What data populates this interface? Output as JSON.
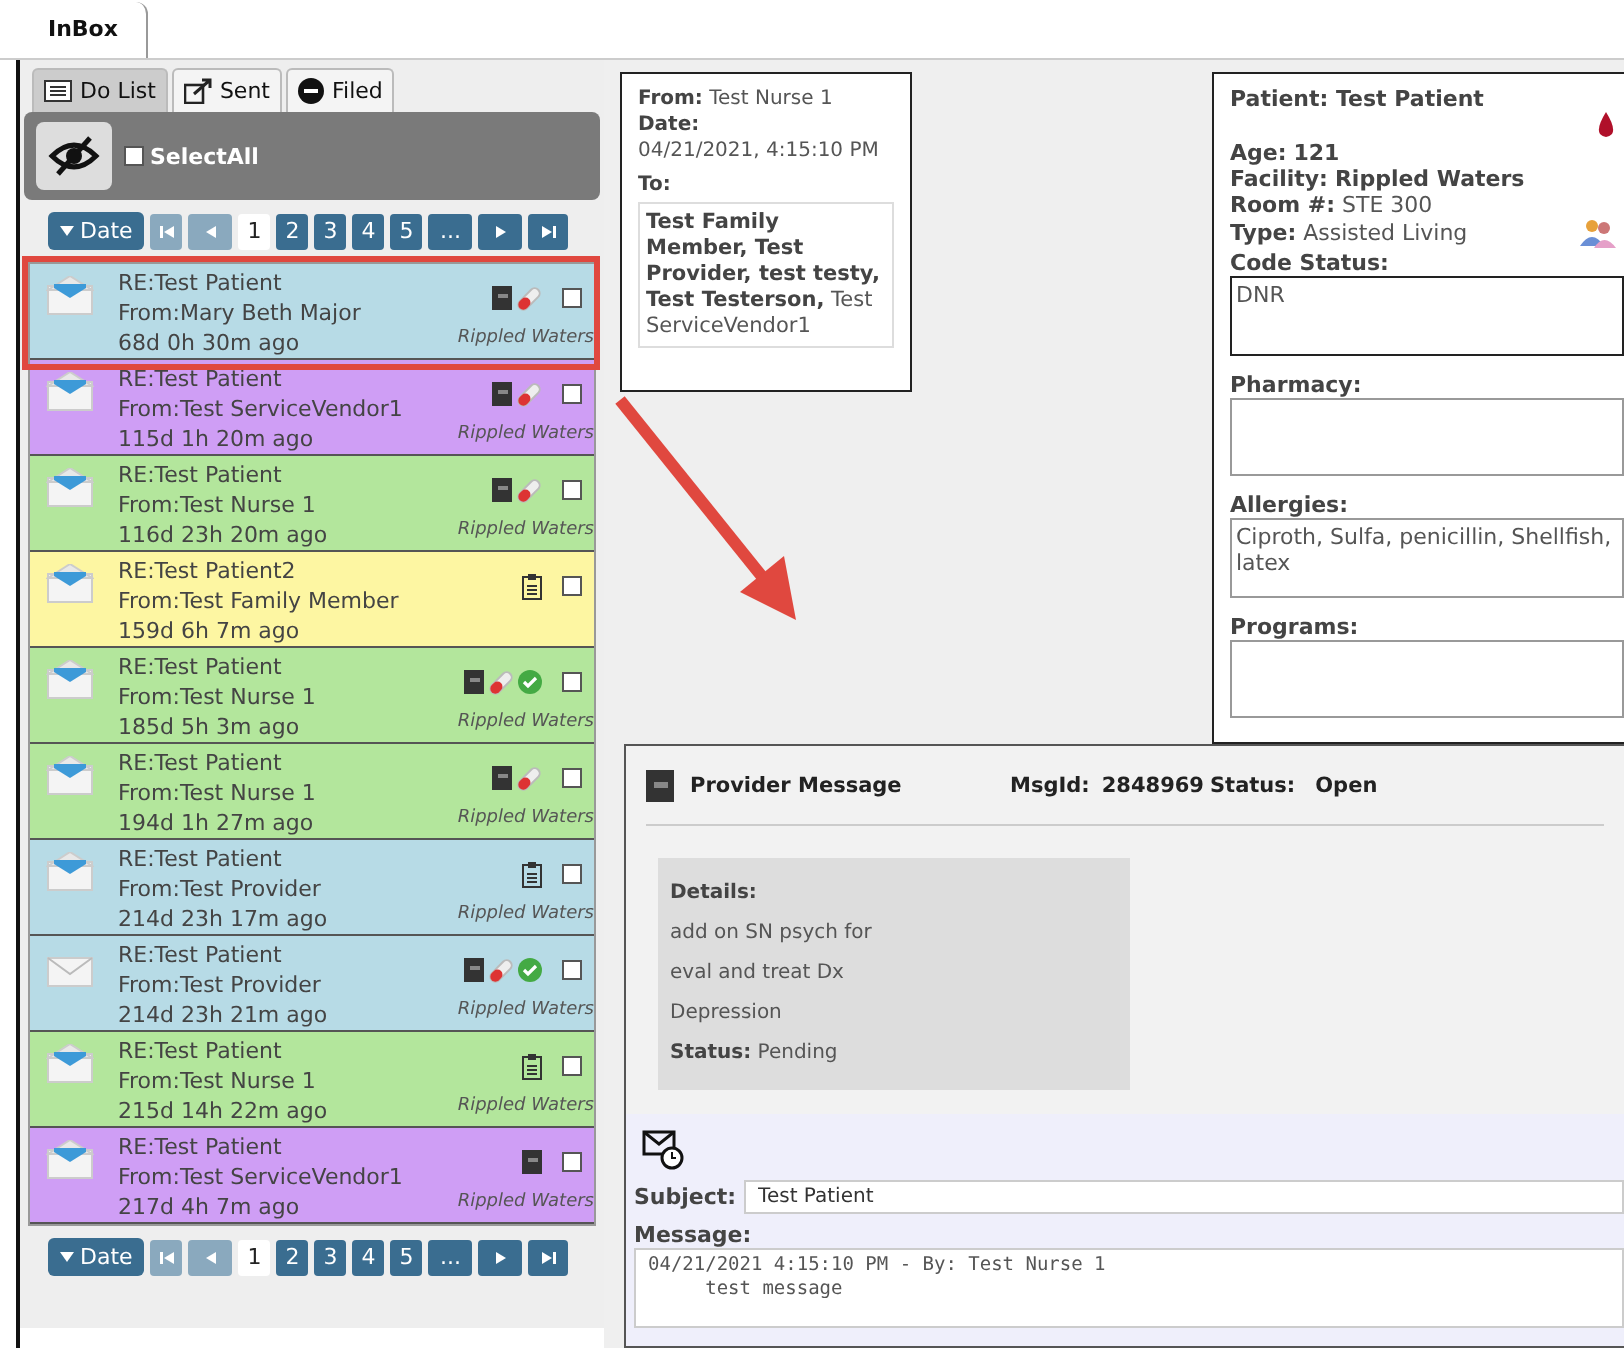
{
  "window": {
    "tab": "InBox"
  },
  "list_tabs": [
    {
      "label": "Do List",
      "kind": "list",
      "selected": true
    },
    {
      "label": "Sent",
      "kind": "send",
      "selected": false
    },
    {
      "label": "Filed",
      "kind": "minus",
      "selected": false
    }
  ],
  "select_all": {
    "label": "SelectAll",
    "checked": false
  },
  "pager_top": {
    "sort": "Date",
    "pages": [
      {
        "label": "1",
        "selected": true
      },
      {
        "label": "2",
        "selected": false
      },
      {
        "label": "3",
        "selected": false
      },
      {
        "label": "4",
        "selected": false
      },
      {
        "label": "5",
        "selected": false
      },
      {
        "label": "...",
        "selected": false
      }
    ]
  },
  "messages": [
    {
      "subject": "RE:Test Patient",
      "from": "From:Mary Beth Major",
      "ago": "68d 0h 30m ago",
      "facility": "Rippled Waters",
      "color": "#b7dbe6",
      "read": false,
      "icons": [
        {
          "kind": "doc"
        },
        {
          "kind": "pill"
        }
      ],
      "checked": false,
      "selected": true
    },
    {
      "subject": "RE:Test Patient",
      "from": "From:Test ServiceVendor1",
      "ago": "115d 1h 20m ago",
      "facility": "Rippled Waters",
      "color": "#cf9ef5",
      "read": false,
      "icons": [
        {
          "kind": "doc"
        },
        {
          "kind": "pill"
        }
      ],
      "checked": false,
      "selected": false
    },
    {
      "subject": "RE:Test Patient",
      "from": "From:Test Nurse 1",
      "ago": "116d 23h 20m ago",
      "facility": "Rippled Waters",
      "color": "#b3e69c",
      "read": false,
      "icons": [
        {
          "kind": "doc"
        },
        {
          "kind": "pill"
        }
      ],
      "checked": false,
      "selected": false
    },
    {
      "subject": "RE:Test Patient2",
      "from": "From:Test Family Member",
      "ago": "159d 6h 7m ago",
      "color": "#fdf6a2",
      "read": false,
      "icons": [
        {
          "kind": "clipboard"
        }
      ],
      "checked": false,
      "selected": false
    },
    {
      "subject": "RE:Test Patient",
      "from": "From:Test Nurse 1",
      "ago": "185d 5h 3m ago",
      "facility": "Rippled Waters",
      "color": "#b3e69c",
      "read": false,
      "icons": [
        {
          "kind": "doc"
        },
        {
          "kind": "pill"
        },
        {
          "kind": "check"
        }
      ],
      "checked": false,
      "selected": false
    },
    {
      "subject": "RE:Test Patient",
      "from": "From:Test Nurse 1",
      "ago": "194d 1h 27m ago",
      "facility": "Rippled Waters",
      "color": "#b3e69c",
      "read": false,
      "icons": [
        {
          "kind": "doc"
        },
        {
          "kind": "pill"
        }
      ],
      "checked": false,
      "selected": false
    },
    {
      "subject": "RE:Test Patient",
      "from": "From:Test Provider",
      "ago": "214d 23h 17m ago",
      "facility": "Rippled Waters",
      "color": "#b7dbe6",
      "read": false,
      "icons": [
        {
          "kind": "clipboard"
        }
      ],
      "checked": false,
      "selected": false
    },
    {
      "subject": "RE:Test Patient",
      "from": "From:Test Provider",
      "ago": "214d 23h 21m ago",
      "facility": "Rippled Waters",
      "color": "#b7dbe6",
      "read": true,
      "icons": [
        {
          "kind": "doc"
        },
        {
          "kind": "pill"
        },
        {
          "kind": "check"
        }
      ],
      "checked": false,
      "selected": false
    },
    {
      "subject": "RE:Test Patient",
      "from": "From:Test Nurse 1",
      "ago": "215d 14h 22m ago",
      "facility": "Rippled Waters",
      "color": "#b3e69c",
      "read": false,
      "icons": [
        {
          "kind": "clipboard"
        }
      ],
      "checked": false,
      "selected": false
    },
    {
      "subject": "RE:Test Patient",
      "from": "From:Test ServiceVendor1",
      "ago": "217d 4h 7m ago",
      "facility": "Rippled Waters",
      "color": "#cf9ef5",
      "read": false,
      "icons": [
        {
          "kind": "doc"
        }
      ],
      "checked": false,
      "selected": false
    }
  ],
  "pager_bottom": {
    "sort": "Date",
    "pages": [
      {
        "label": "1",
        "selected": true
      },
      {
        "label": "2",
        "selected": false
      },
      {
        "label": "3",
        "selected": false
      },
      {
        "label": "4",
        "selected": false
      },
      {
        "label": "5",
        "selected": false
      },
      {
        "label": "...",
        "selected": false
      }
    ]
  },
  "header": {
    "from_label": "From:",
    "from": "Test Nurse 1",
    "date_label": "Date:",
    "date": "04/21/2021, 4:15:10 PM",
    "to_label": "To:",
    "to": "**Test Family Member, Test Provider, test testy, Test Testerson,** Test ServiceVendor1"
  },
  "patient": {
    "title": "Patient: Test Patient",
    "facts": [
      {
        "label": "Age:",
        "value": "121",
        "bold": true
      },
      {
        "label": "Facility:",
        "value": "Rippled Waters",
        "bold": true
      },
      {
        "label": "Room #:",
        "value": "STE 300",
        "bold": false
      },
      {
        "label": "Type:",
        "value": "Assisted Living",
        "bold": false
      }
    ],
    "fields": [
      {
        "label": "Code Status:",
        "value": "DNR",
        "dark": true
      },
      {
        "label": "Pharmacy:",
        "dark": false
      },
      {
        "label": "Allergies:",
        "value": "Ciproth, Sulfa, penicillin, Shellfish, latex",
        "dark": false
      },
      {
        "label": "Programs:",
        "dark": false
      }
    ]
  },
  "message": {
    "type": "Provider Message",
    "msgid_label": "MsgId:",
    "msgid": "2848969",
    "status_label": "Status:",
    "status": "Open",
    "details_label": "Details:",
    "details": "add on SN psych for eval and treat Dx Depression",
    "detail_status_label": "Status:",
    "detail_status": "Pending",
    "subject_label": "Subject:",
    "subject": "Test Patient",
    "message_label": "Message:",
    "body": [
      "04/21/2021 4:15:10 PM - By: Test Nurse 1",
      "     test message"
    ]
  }
}
